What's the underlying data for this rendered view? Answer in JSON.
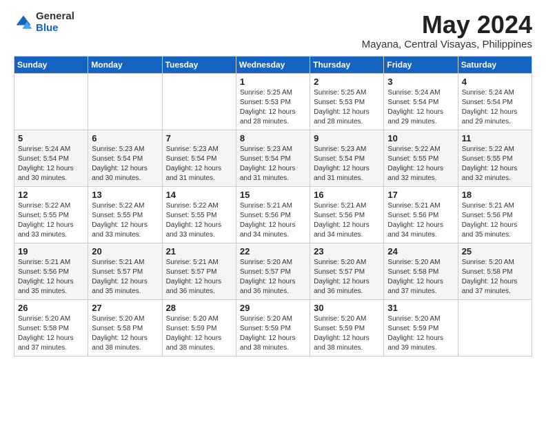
{
  "logo": {
    "general": "General",
    "blue": "Blue"
  },
  "header": {
    "month": "May 2024",
    "location": "Mayana, Central Visayas, Philippines"
  },
  "weekdays": [
    "Sunday",
    "Monday",
    "Tuesday",
    "Wednesday",
    "Thursday",
    "Friday",
    "Saturday"
  ],
  "weeks": [
    [
      {
        "day": "",
        "info": ""
      },
      {
        "day": "",
        "info": ""
      },
      {
        "day": "",
        "info": ""
      },
      {
        "day": "1",
        "info": "Sunrise: 5:25 AM\nSunset: 5:53 PM\nDaylight: 12 hours\nand 28 minutes."
      },
      {
        "day": "2",
        "info": "Sunrise: 5:25 AM\nSunset: 5:53 PM\nDaylight: 12 hours\nand 28 minutes."
      },
      {
        "day": "3",
        "info": "Sunrise: 5:24 AM\nSunset: 5:54 PM\nDaylight: 12 hours\nand 29 minutes."
      },
      {
        "day": "4",
        "info": "Sunrise: 5:24 AM\nSunset: 5:54 PM\nDaylight: 12 hours\nand 29 minutes."
      }
    ],
    [
      {
        "day": "5",
        "info": "Sunrise: 5:24 AM\nSunset: 5:54 PM\nDaylight: 12 hours\nand 30 minutes."
      },
      {
        "day": "6",
        "info": "Sunrise: 5:23 AM\nSunset: 5:54 PM\nDaylight: 12 hours\nand 30 minutes."
      },
      {
        "day": "7",
        "info": "Sunrise: 5:23 AM\nSunset: 5:54 PM\nDaylight: 12 hours\nand 31 minutes."
      },
      {
        "day": "8",
        "info": "Sunrise: 5:23 AM\nSunset: 5:54 PM\nDaylight: 12 hours\nand 31 minutes."
      },
      {
        "day": "9",
        "info": "Sunrise: 5:23 AM\nSunset: 5:54 PM\nDaylight: 12 hours\nand 31 minutes."
      },
      {
        "day": "10",
        "info": "Sunrise: 5:22 AM\nSunset: 5:55 PM\nDaylight: 12 hours\nand 32 minutes."
      },
      {
        "day": "11",
        "info": "Sunrise: 5:22 AM\nSunset: 5:55 PM\nDaylight: 12 hours\nand 32 minutes."
      }
    ],
    [
      {
        "day": "12",
        "info": "Sunrise: 5:22 AM\nSunset: 5:55 PM\nDaylight: 12 hours\nand 33 minutes."
      },
      {
        "day": "13",
        "info": "Sunrise: 5:22 AM\nSunset: 5:55 PM\nDaylight: 12 hours\nand 33 minutes."
      },
      {
        "day": "14",
        "info": "Sunrise: 5:22 AM\nSunset: 5:55 PM\nDaylight: 12 hours\nand 33 minutes."
      },
      {
        "day": "15",
        "info": "Sunrise: 5:21 AM\nSunset: 5:56 PM\nDaylight: 12 hours\nand 34 minutes."
      },
      {
        "day": "16",
        "info": "Sunrise: 5:21 AM\nSunset: 5:56 PM\nDaylight: 12 hours\nand 34 minutes."
      },
      {
        "day": "17",
        "info": "Sunrise: 5:21 AM\nSunset: 5:56 PM\nDaylight: 12 hours\nand 34 minutes."
      },
      {
        "day": "18",
        "info": "Sunrise: 5:21 AM\nSunset: 5:56 PM\nDaylight: 12 hours\nand 35 minutes."
      }
    ],
    [
      {
        "day": "19",
        "info": "Sunrise: 5:21 AM\nSunset: 5:56 PM\nDaylight: 12 hours\nand 35 minutes."
      },
      {
        "day": "20",
        "info": "Sunrise: 5:21 AM\nSunset: 5:57 PM\nDaylight: 12 hours\nand 35 minutes."
      },
      {
        "day": "21",
        "info": "Sunrise: 5:21 AM\nSunset: 5:57 PM\nDaylight: 12 hours\nand 36 minutes."
      },
      {
        "day": "22",
        "info": "Sunrise: 5:20 AM\nSunset: 5:57 PM\nDaylight: 12 hours\nand 36 minutes."
      },
      {
        "day": "23",
        "info": "Sunrise: 5:20 AM\nSunset: 5:57 PM\nDaylight: 12 hours\nand 36 minutes."
      },
      {
        "day": "24",
        "info": "Sunrise: 5:20 AM\nSunset: 5:58 PM\nDaylight: 12 hours\nand 37 minutes."
      },
      {
        "day": "25",
        "info": "Sunrise: 5:20 AM\nSunset: 5:58 PM\nDaylight: 12 hours\nand 37 minutes."
      }
    ],
    [
      {
        "day": "26",
        "info": "Sunrise: 5:20 AM\nSunset: 5:58 PM\nDaylight: 12 hours\nand 37 minutes."
      },
      {
        "day": "27",
        "info": "Sunrise: 5:20 AM\nSunset: 5:58 PM\nDaylight: 12 hours\nand 38 minutes."
      },
      {
        "day": "28",
        "info": "Sunrise: 5:20 AM\nSunset: 5:59 PM\nDaylight: 12 hours\nand 38 minutes."
      },
      {
        "day": "29",
        "info": "Sunrise: 5:20 AM\nSunset: 5:59 PM\nDaylight: 12 hours\nand 38 minutes."
      },
      {
        "day": "30",
        "info": "Sunrise: 5:20 AM\nSunset: 5:59 PM\nDaylight: 12 hours\nand 38 minutes."
      },
      {
        "day": "31",
        "info": "Sunrise: 5:20 AM\nSunset: 5:59 PM\nDaylight: 12 hours\nand 39 minutes."
      },
      {
        "day": "",
        "info": ""
      }
    ]
  ]
}
